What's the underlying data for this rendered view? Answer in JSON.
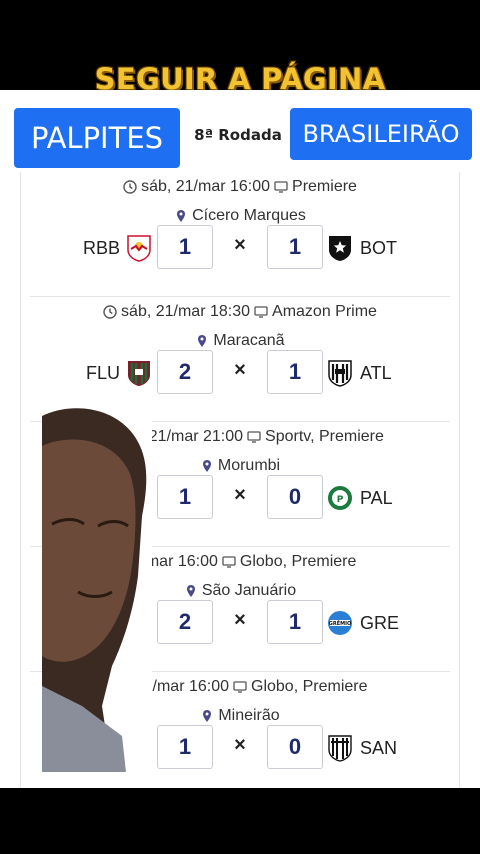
{
  "banner": {
    "text": "SEGUIR A PÁGINA"
  },
  "header": {
    "left_pill": "PALPITES",
    "round": "8ª Rodada",
    "right_pill": "BRASILEIRÃO"
  },
  "matches": [
    {
      "datetime": "sáb, 21/mar 16:00",
      "broadcast": "Premiere",
      "venue": "Cícero Marques",
      "home": "RBB",
      "away": "BOT",
      "home_score": "1",
      "away_score": "1",
      "sep": "×"
    },
    {
      "datetime": "sáb, 21/mar 18:30",
      "broadcast": "Amazon Prime",
      "venue": "Maracanã",
      "home": "FLU",
      "away": "ATL",
      "home_score": "2",
      "away_score": "1",
      "sep": "×"
    },
    {
      "datetime": "sáb, 21/mar 21:00",
      "broadcast": "Sportv, Premiere",
      "venue": "Morumbi",
      "home": "",
      "away": "PAL",
      "home_score": "1",
      "away_score": "0",
      "sep": "×"
    },
    {
      "datetime": "22/mar 16:00",
      "broadcast": "Globo, Premiere",
      "venue": "São Januário",
      "home": "",
      "away": "GRE",
      "home_score": "2",
      "away_score": "1",
      "sep": "×"
    },
    {
      "datetime": "m, 22/mar 16:00",
      "broadcast": "Globo, Premiere",
      "venue": "Mineirão",
      "home": "",
      "away": "SAN",
      "home_score": "1",
      "away_score": "0",
      "sep": "×"
    }
  ],
  "colors": {
    "banner_gold": "#f2c230",
    "pill_blue": "#1f6ff2",
    "score_text": "#1f2a6b"
  }
}
